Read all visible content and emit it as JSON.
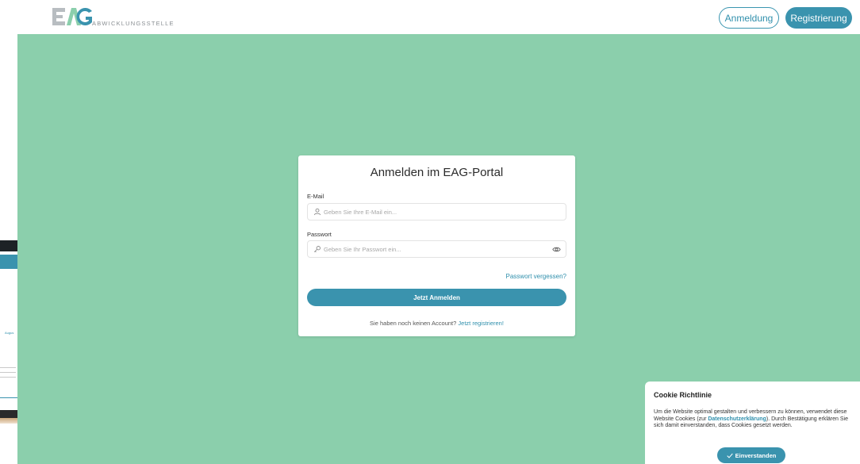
{
  "header": {
    "logo_sub": "ABWICKLUNGSSTELLE",
    "login_label": "Anmeldung",
    "register_label": "Registrierung"
  },
  "login": {
    "title": "Anmelden im EAG-Portal",
    "email_label": "E-Mail",
    "email_placeholder": "Geben Sie Ihre E-Mail ein...",
    "password_label": "Passwort",
    "password_placeholder": "Geben Sie Ihr Passwort ein...",
    "forgot_label": "Passwort vergessen?",
    "submit_label": "Jetzt Anmelden",
    "no_account_text": "Sie haben noch keinen Account?",
    "register_link": "Jetzt registrieren!"
  },
  "cookie": {
    "title": "Cookie Richtlinie",
    "text_before": "Um die Website optimal gestalten und verbessern zu können, verwendet diese Website Cookies (zur ",
    "link": "Datenschutzerklärung",
    "text_after": "). Durch Bestätigung erklären Sie sich damit einverstanden, dass Cookies gesetzt werden.",
    "accept_label": "Einverstanden"
  },
  "background_page": {
    "fragment_text": "Augus"
  },
  "colors": {
    "accent": "#3a93ae",
    "background": "#8bcfac",
    "link": "#2f8fac"
  },
  "icons": [
    "eag-logo",
    "user-icon",
    "key-icon",
    "eye-icon",
    "check-icon"
  ]
}
